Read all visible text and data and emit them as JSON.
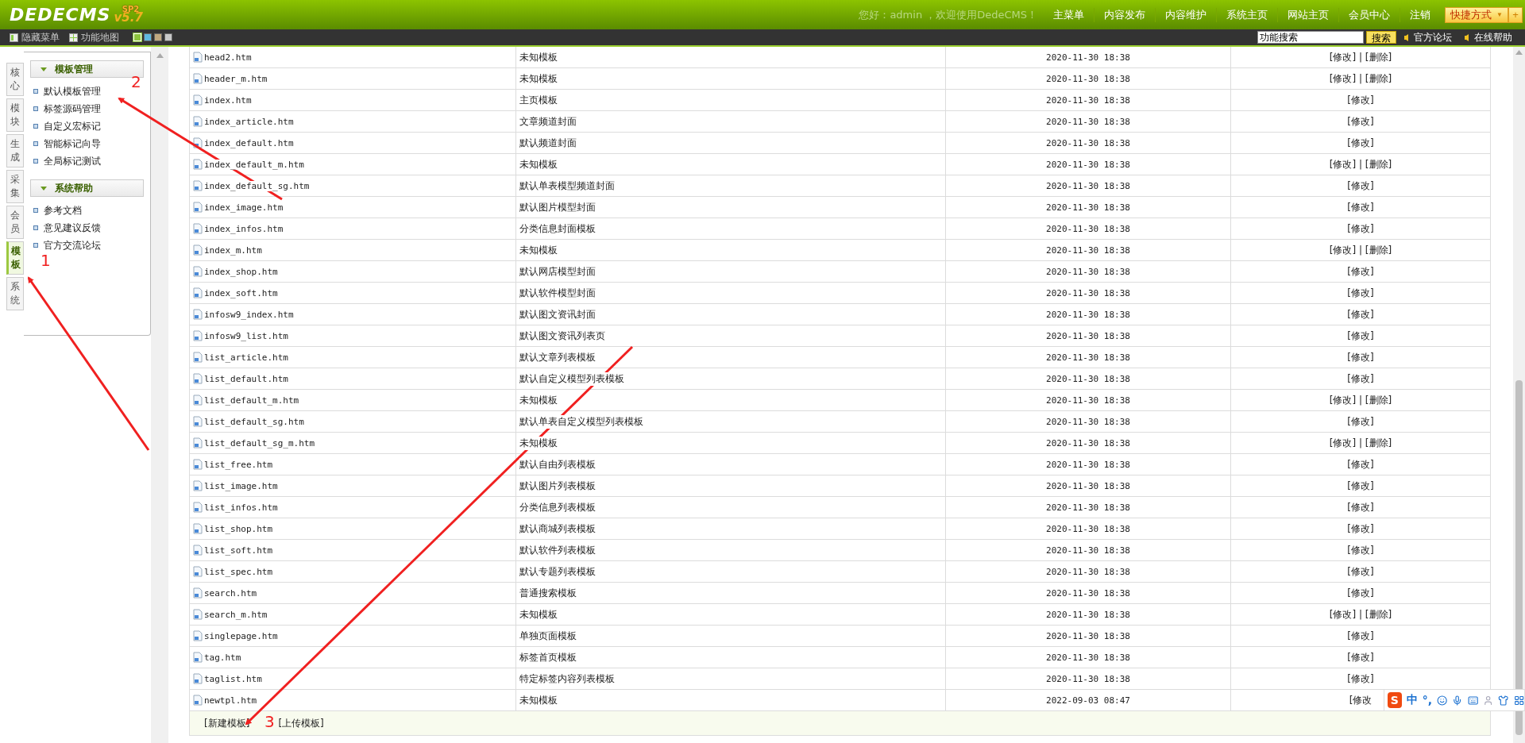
{
  "header": {
    "logo": "DEDECMS",
    "version": "v5.7",
    "edition": "SP2",
    "greeting": "您好：admin ，欢迎使用DedeCMS！",
    "nav": [
      "主菜单",
      "内容发布",
      "内容维护",
      "系统主页",
      "网站主页",
      "会员中心",
      "注销"
    ],
    "shortcut": {
      "label": "快捷方式",
      "caret": "▼",
      "plus": "+"
    }
  },
  "toolbar": {
    "hide_menu": "隐藏菜单",
    "function_map": "功能地图",
    "themes": [
      {
        "color": "#8cc43c",
        "selected": true
      },
      {
        "color": "#5fb8e0",
        "selected": false
      },
      {
        "color": "#c0a880",
        "selected": false
      },
      {
        "color": "#c8c8c8",
        "selected": false
      }
    ],
    "search": {
      "value": "功能搜索",
      "button": "搜索"
    },
    "links": [
      "官方论坛",
      "在线帮助"
    ]
  },
  "side_tabs": [
    {
      "label": "核心",
      "selected": false
    },
    {
      "label": "模块",
      "selected": false
    },
    {
      "label": "生成",
      "selected": false
    },
    {
      "label": "采集",
      "selected": false
    },
    {
      "label": "会员",
      "selected": false
    },
    {
      "label": "模板",
      "selected": true
    },
    {
      "label": "系统",
      "selected": false
    }
  ],
  "menu_sections": [
    {
      "title": "模板管理",
      "expanded": true,
      "items": [
        "默认模板管理",
        "标签源码管理",
        "自定义宏标记",
        "智能标记向导",
        "全局标记测试"
      ]
    },
    {
      "title": "系统帮助",
      "expanded": true,
      "items": [
        "参考文档",
        "意见建议反馈",
        "官方交流论坛"
      ]
    }
  ],
  "table": {
    "rows": [
      {
        "file": "head2.htm",
        "description": "未知模板",
        "date": "2020-11-30 18:38",
        "action": "[修改] | [删除]"
      },
      {
        "file": "header_m.htm",
        "description": "未知模板",
        "date": "2020-11-30 18:38",
        "action": "[修改] | [删除]"
      },
      {
        "file": "index.htm",
        "description": "主页模板",
        "date": "2020-11-30 18:38",
        "action": "[修改]"
      },
      {
        "file": "index_article.htm",
        "description": "文章频道封面",
        "date": "2020-11-30 18:38",
        "action": "[修改]"
      },
      {
        "file": "index_default.htm",
        "description": "默认频道封面",
        "date": "2020-11-30 18:38",
        "action": "[修改]"
      },
      {
        "file": "index_default_m.htm",
        "description": "未知模板",
        "date": "2020-11-30 18:38",
        "action": "[修改] | [删除]"
      },
      {
        "file": "index_default_sg.htm",
        "description": "默认单表模型频道封面",
        "date": "2020-11-30 18:38",
        "action": "[修改]"
      },
      {
        "file": "index_image.htm",
        "description": "默认图片模型封面",
        "date": "2020-11-30 18:38",
        "action": "[修改]"
      },
      {
        "file": "index_infos.htm",
        "description": "分类信息封面模板",
        "date": "2020-11-30 18:38",
        "action": "[修改]"
      },
      {
        "file": "index_m.htm",
        "description": "未知模板",
        "date": "2020-11-30 18:38",
        "action": "[修改] | [删除]"
      },
      {
        "file": "index_shop.htm",
        "description": "默认网店模型封面",
        "date": "2020-11-30 18:38",
        "action": "[修改]"
      },
      {
        "file": "index_soft.htm",
        "description": "默认软件模型封面",
        "date": "2020-11-30 18:38",
        "action": "[修改]"
      },
      {
        "file": "infosw9_index.htm",
        "description": "默认图文资讯封面",
        "date": "2020-11-30 18:38",
        "action": "[修改]"
      },
      {
        "file": "infosw9_list.htm",
        "description": "默认图文资讯列表页",
        "date": "2020-11-30 18:38",
        "action": "[修改]"
      },
      {
        "file": "list_article.htm",
        "description": "默认文章列表模板",
        "date": "2020-11-30 18:38",
        "action": "[修改]"
      },
      {
        "file": "list_default.htm",
        "description": "默认自定义模型列表模板",
        "date": "2020-11-30 18:38",
        "action": "[修改]"
      },
      {
        "file": "list_default_m.htm",
        "description": "未知模板",
        "date": "2020-11-30 18:38",
        "action": "[修改] | [删除]"
      },
      {
        "file": "list_default_sg.htm",
        "description": "默认单表自定义模型列表模板",
        "date": "2020-11-30 18:38",
        "action": "[修改]"
      },
      {
        "file": "list_default_sg_m.htm",
        "description": "未知模板",
        "date": "2020-11-30 18:38",
        "action": "[修改] | [删除]"
      },
      {
        "file": "list_free.htm",
        "description": "默认自由列表模板",
        "date": "2020-11-30 18:38",
        "action": "[修改]"
      },
      {
        "file": "list_image.htm",
        "description": "默认图片列表模板",
        "date": "2020-11-30 18:38",
        "action": "[修改]"
      },
      {
        "file": "list_infos.htm",
        "description": "分类信息列表模板",
        "date": "2020-11-30 18:38",
        "action": "[修改]"
      },
      {
        "file": "list_shop.htm",
        "description": "默认商城列表模板",
        "date": "2020-11-30 18:38",
        "action": "[修改]"
      },
      {
        "file": "list_soft.htm",
        "description": "默认软件列表模板",
        "date": "2020-11-30 18:38",
        "action": "[修改]"
      },
      {
        "file": "list_spec.htm",
        "description": "默认专题列表模板",
        "date": "2020-11-30 18:38",
        "action": "[修改]"
      },
      {
        "file": "search.htm",
        "description": "普通搜索模板",
        "date": "2020-11-30 18:38",
        "action": "[修改]"
      },
      {
        "file": "search_m.htm",
        "description": "未知模板",
        "date": "2020-11-30 18:38",
        "action": "[修改] | [删除]"
      },
      {
        "file": "singlepage.htm",
        "description": "单独页面模板",
        "date": "2020-11-30 18:38",
        "action": "[修改]"
      },
      {
        "file": "tag.htm",
        "description": "标签首页模板",
        "date": "2020-11-30 18:38",
        "action": "[修改]"
      },
      {
        "file": "taglist.htm",
        "description": "特定标签内容列表模板",
        "date": "2020-11-30 18:38",
        "action": "[修改]"
      },
      {
        "file": "newtpl.htm",
        "description": "未知模板",
        "date": "2022-09-03 08:47",
        "action": "[修改"
      }
    ],
    "footer_links": [
      "[新建模板]",
      "[上传模板]"
    ]
  },
  "ime_bar": {
    "logo": "S",
    "mode": "中",
    "punctuation": "°,"
  },
  "annotations": [
    {
      "label": "1"
    },
    {
      "label": "2"
    },
    {
      "label": "3"
    }
  ]
}
